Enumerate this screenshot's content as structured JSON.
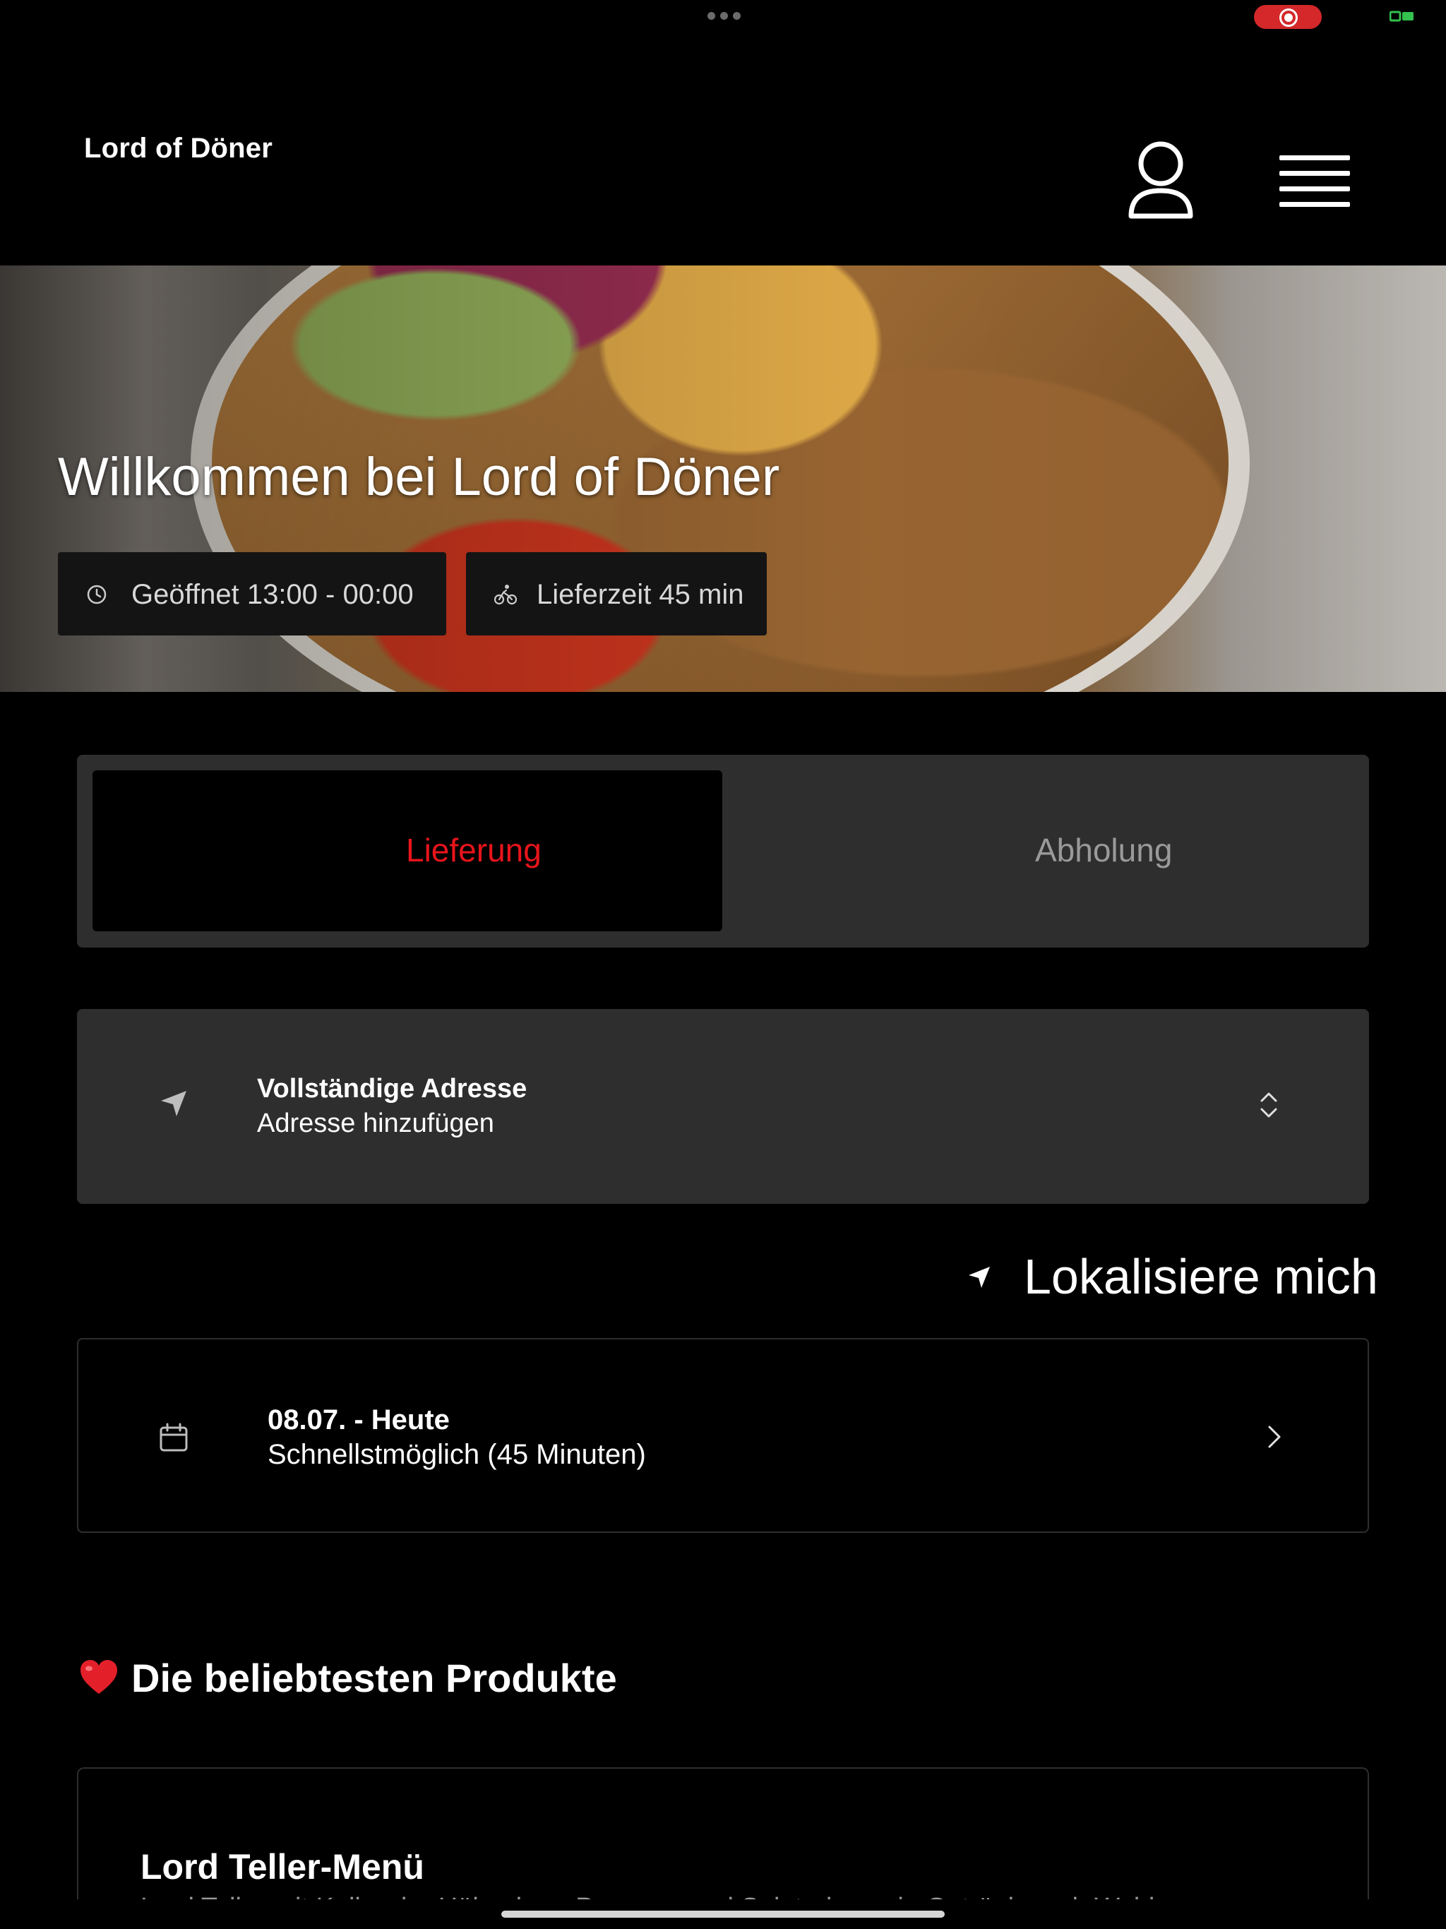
{
  "app": {
    "brand": "Lord of Döner"
  },
  "hero": {
    "title": "Willkommen bei Lord of Döner",
    "opening": "Geöffnet 13:00 - 00:00",
    "delivery_time": "Lieferzeit 45 min"
  },
  "order_mode": {
    "options": [
      "Lieferung",
      "Abholung"
    ],
    "selected": "Lieferung",
    "active_color": "#e8141b"
  },
  "address": {
    "title": "Vollständige Adresse",
    "placeholder": "Adresse hinzufügen"
  },
  "locate": {
    "label": "Lokalisiere mich"
  },
  "schedule": {
    "date": "08.07. - Heute",
    "time": "Schnellstmöglich (45 Minuten)"
  },
  "popular": {
    "title": "Die beliebtesten Produkte",
    "products": [
      {
        "name": "Lord Teller-Menü",
        "description": "Lord Teller mit Kalb oder Hähnchen, Pommes und Salat, dazu ein Getränk nach Wahl"
      }
    ]
  },
  "icons": {
    "user": "user-icon",
    "menu": "hamburger-menu-icon",
    "clock": "clock-icon",
    "bike": "bike-icon",
    "location": "location-arrow-icon",
    "updown": "chevron-up-down-icon",
    "calendar": "calendar-icon",
    "chevron": "chevron-right-icon",
    "heart": "heart-icon"
  }
}
